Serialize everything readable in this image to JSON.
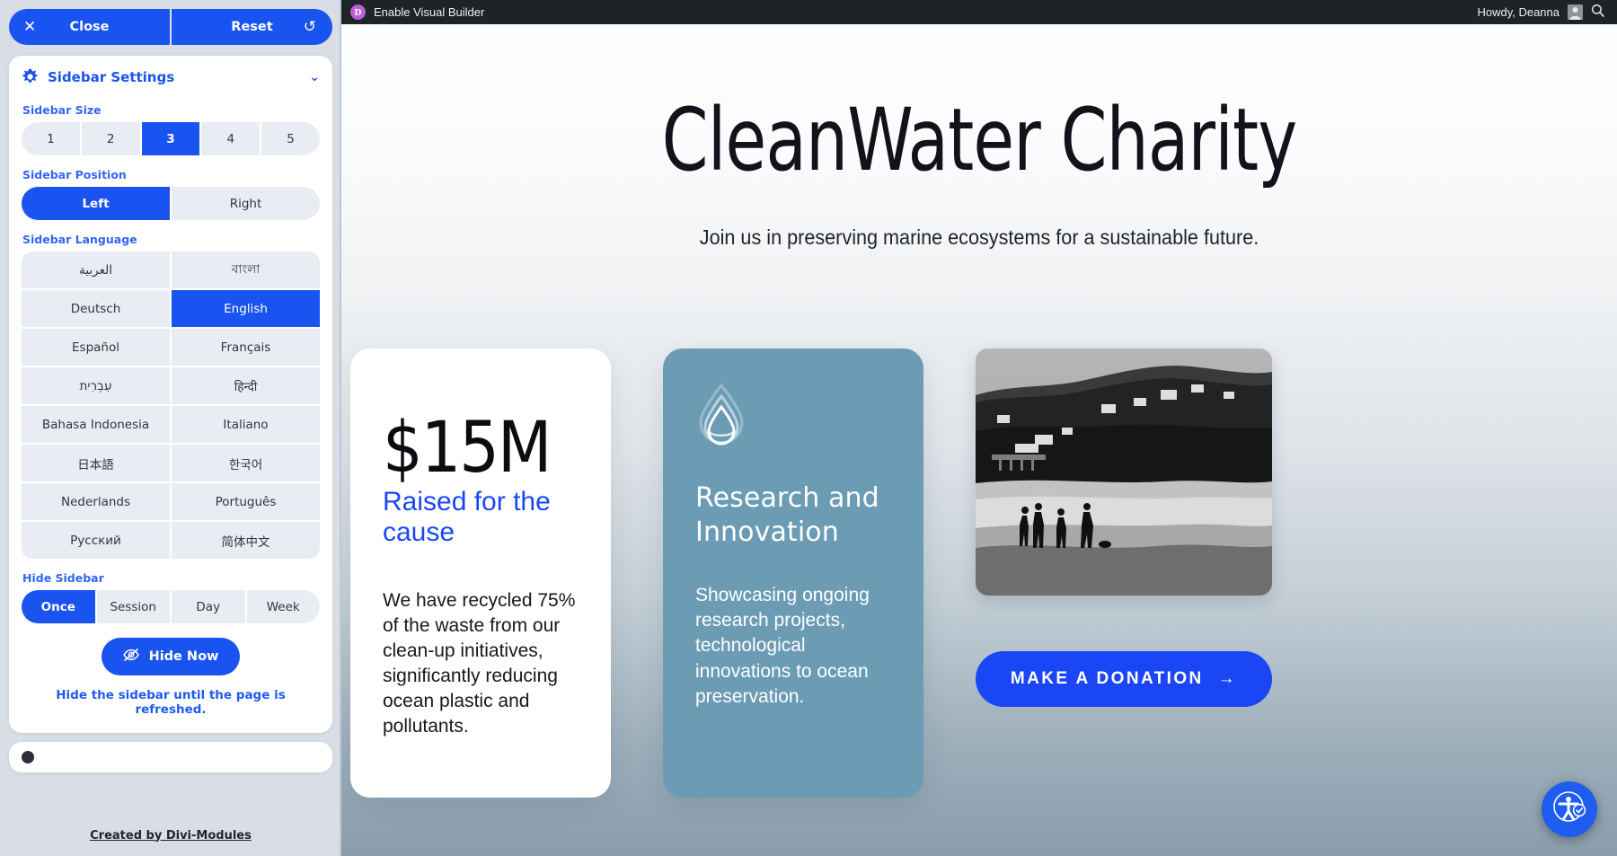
{
  "adminbar": {
    "divi_badge": "D",
    "enable_visual_builder": "Enable Visual Builder",
    "howdy": "Howdy, Deanna",
    "avatar_icon": "avatar-icon",
    "search_icon": "search-icon"
  },
  "hero": {
    "title": "CleanWater Charity",
    "subtitle": "Join us in preserving marine ecosystems for a sustainable future."
  },
  "cards": {
    "stat_card": {
      "number": "$15M",
      "label": "Raised for the cause",
      "body": "We have recycled 75% of the waste from our clean-up initiatives, significantly reducing ocean plastic and pollutants."
    },
    "research_card": {
      "icon": "water-drop-icon",
      "title": "Research and Innovation",
      "body": "Showcasing ongoing research projects, technological innovations to ocean preservation."
    },
    "photo_card": {
      "image_alt": "beach-coastline-photo",
      "donate_label": "MAKE A DONATION",
      "donate_arrow": "→"
    }
  },
  "a11y_widget": {
    "icon": "accessibility-icon"
  },
  "sidebar_panel": {
    "close_label": "Close",
    "close_icon": "close-icon",
    "reset_label": "Reset",
    "reset_icon": "reset-icon",
    "accordion": {
      "icon": "gear-icon",
      "title": "Sidebar Settings",
      "chevron": "chevron-down-icon"
    },
    "sidebar_size": {
      "label": "Sidebar Size",
      "options": [
        "1",
        "2",
        "3",
        "4",
        "5"
      ],
      "selected": "3"
    },
    "sidebar_position": {
      "label": "Sidebar Position",
      "options": [
        "Left",
        "Right"
      ],
      "selected": "Left"
    },
    "sidebar_language": {
      "label": "Sidebar Language",
      "options": [
        "العربية",
        "বাংলা",
        "Deutsch",
        "English",
        "Español",
        "Français",
        "עִבְרִית",
        "हिन्दी",
        "Bahasa Indonesia",
        "Italiano",
        "日本語",
        "한국어",
        "Nederlands",
        "Português",
        "Русский",
        "简体中文"
      ],
      "selected": "English"
    },
    "hide_sidebar": {
      "label": "Hide Sidebar",
      "options": [
        "Once",
        "Session",
        "Day",
        "Week"
      ],
      "selected": "Once",
      "hide_now_label": "Hide Now",
      "hide_now_icon": "eye-off-icon",
      "hint": "Hide the sidebar until the page is refreshed."
    },
    "footer_link": "Created by Divi-Modules"
  },
  "colors": {
    "accent_blue": "#1a54f0",
    "panel_bg": "#d9dee6",
    "teal_card": "#6b9cb4",
    "adminbar": "#1d2327"
  }
}
